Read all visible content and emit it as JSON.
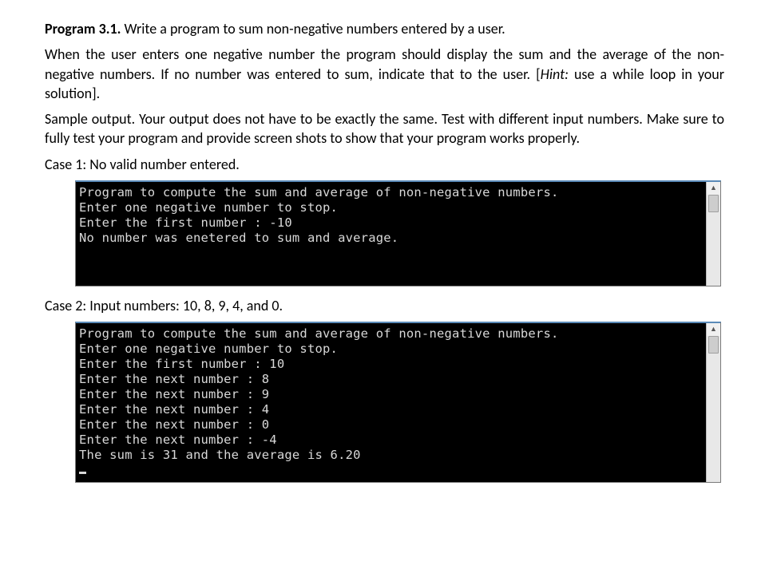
{
  "heading_bold": "Program 3.1.",
  "heading_rest": " Write a program to sum non-negative numbers entered by a user.",
  "para1_pre": "When the user enters one negative number the program should display the sum and the average of the non-negative numbers. If no number was entered to sum, indicate that to the user. [",
  "para1_hint": "Hint:",
  "para1_post": " use a while loop in your solution].",
  "para2": "Sample output. Your output does not have to be exactly the same. Test with different input numbers. Make sure to fully test your program and provide screen shots to show that your program works properly.",
  "case1_label": "Case 1: No valid number entered.",
  "case1_console": "Program to compute the sum and average of non-negative numbers.\nEnter one negative number to stop.\nEnter the first number : -10\nNo number was enetered to sum and average.",
  "case2_label": "Case 2: Input numbers: 10, 8, 9, 4, and 0.",
  "case2_console": "Program to compute the sum and average of non-negative numbers.\nEnter one negative number to stop.\nEnter the first number : 10\nEnter the next number : 8\nEnter the next number : 9\nEnter the next number : 4\nEnter the next number : 0\nEnter the next number : -4\nThe sum is 31 and the average is 6.20",
  "scrollbar": {
    "up": "▲",
    "down": "▼"
  }
}
